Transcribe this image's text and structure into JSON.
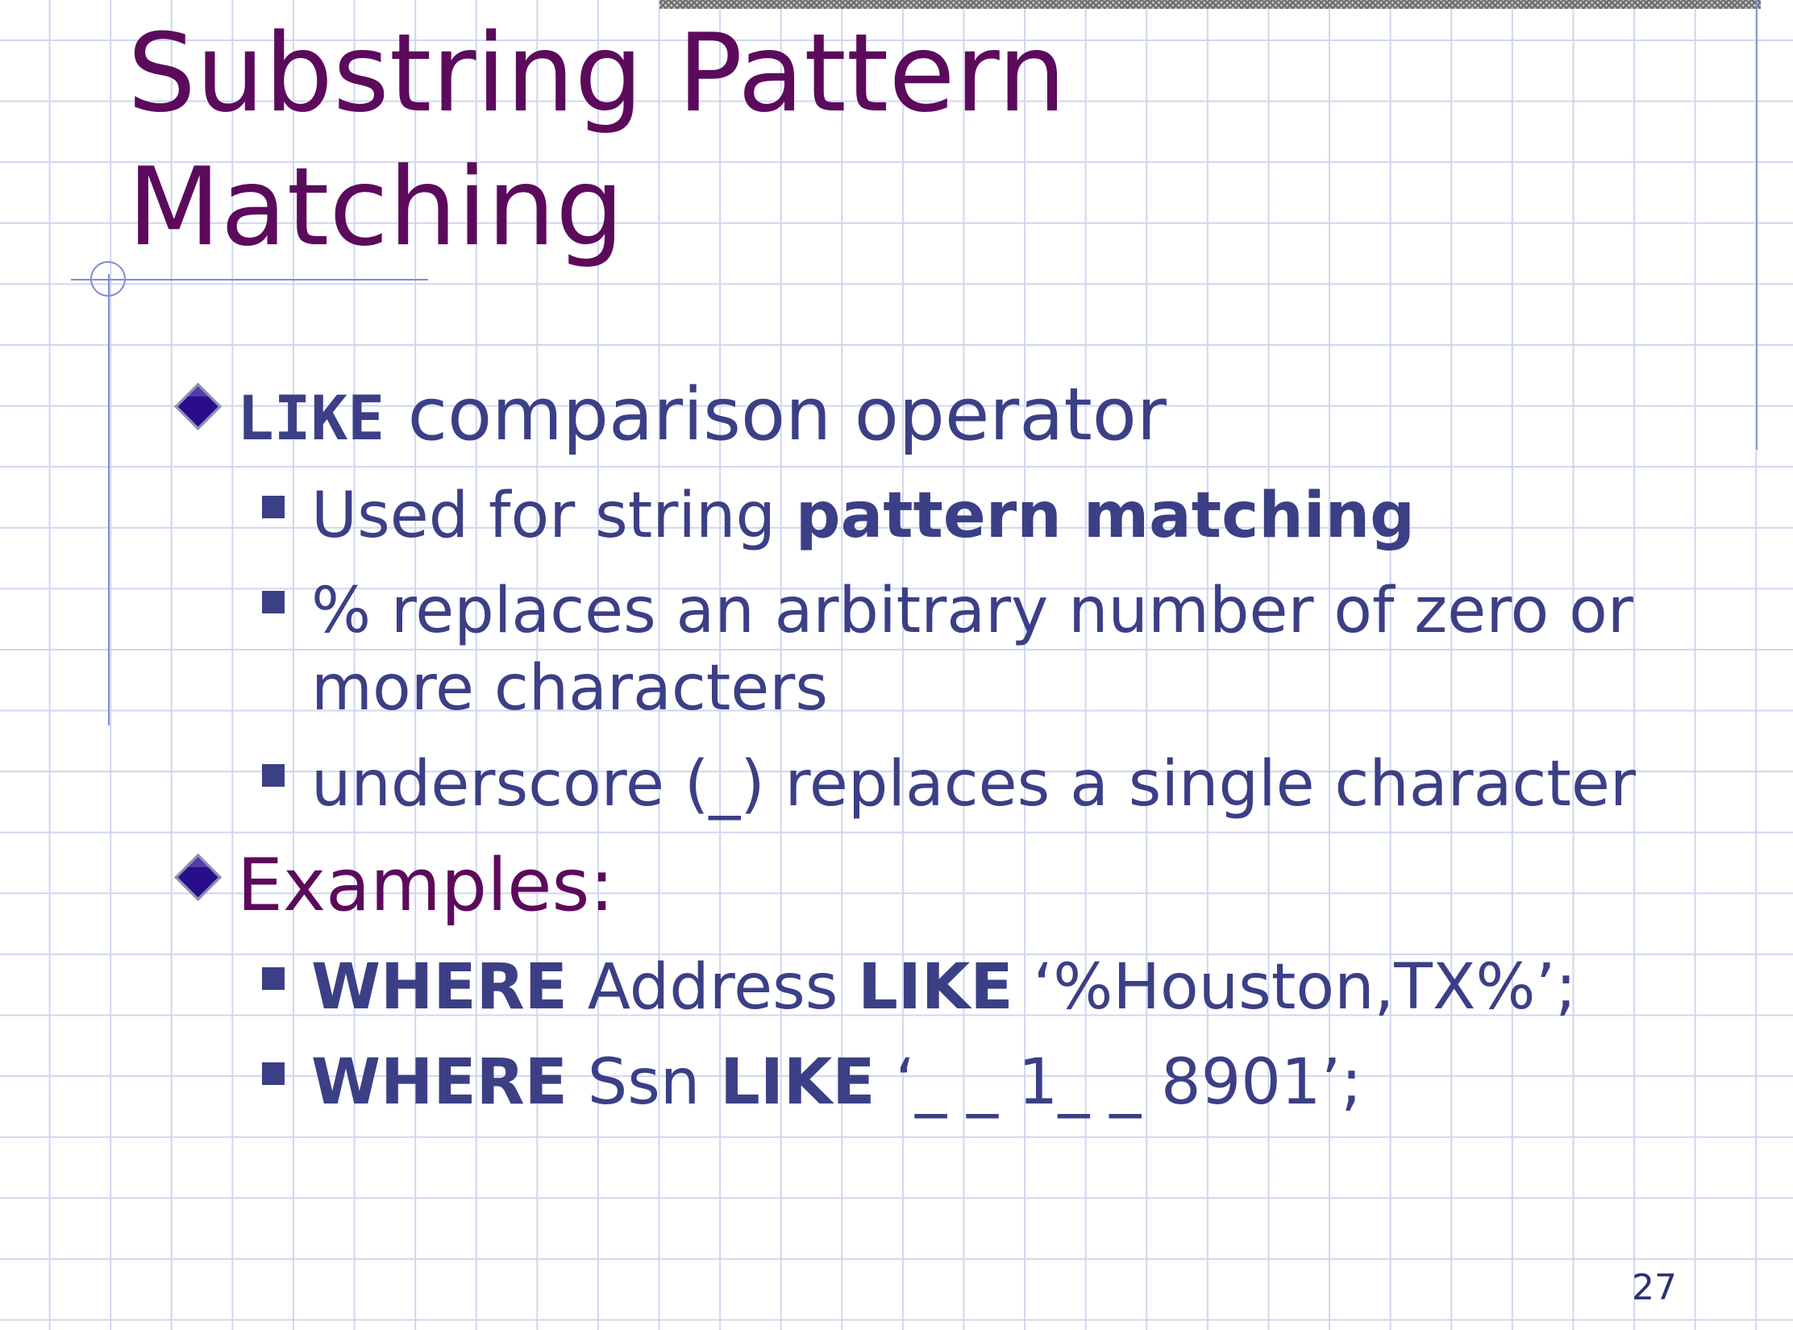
{
  "slide": {
    "title_line1": "Substring Pattern",
    "title_line2": "Matching",
    "bullet1": {
      "keyword": "LIKE",
      "text": " comparison operator",
      "subitems": {
        "s1_text": "Used for string ",
        "s1_bold": "pattern matching",
        "s2_line1": "% replaces an arbitrary number of zero or",
        "s2_line2": "more characters",
        "s3_text": "underscore (_) replaces a single character"
      }
    },
    "bullet2": {
      "label": "Examples:",
      "ex1": {
        "kw1": "WHERE",
        "col": " Address ",
        "kw2": "LIKE",
        "pattern": " ‘%Houston,TX%’;"
      },
      "ex2": {
        "kw1": "WHERE",
        "col": " Ssn ",
        "kw2": "LIKE",
        "pattern": " ‘_ _ 1_ _ 8901’;"
      }
    },
    "page_number": "27"
  },
  "colors": {
    "title": "#5c0a5c",
    "level1_text": "#3b3f86",
    "level2_text": "#3b3f86",
    "examples_label": "#5c0a5c",
    "diamond": "#2a0d8a",
    "grid": "#cfd6ef",
    "rule": "#7f8bd3"
  },
  "icons": {
    "level1_bullet": "diamond-bullet-icon",
    "level2_bullet": "square-bullet-icon"
  }
}
